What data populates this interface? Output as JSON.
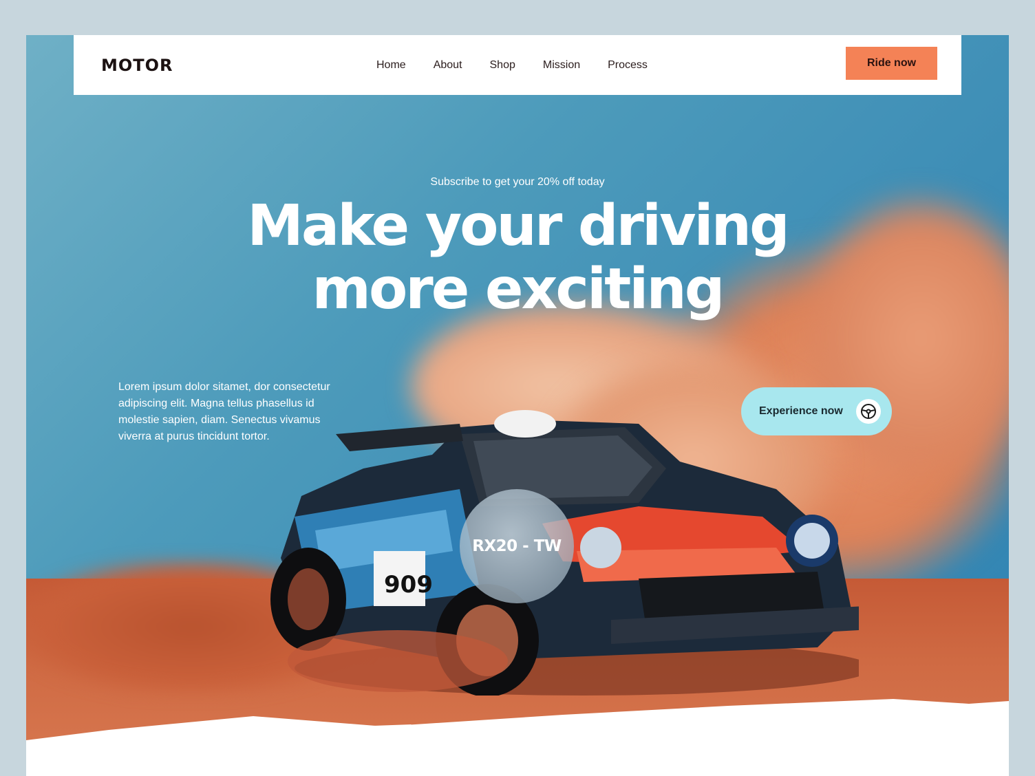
{
  "brand": {
    "logo": "MOTOR"
  },
  "nav": {
    "items": [
      {
        "label": "Home"
      },
      {
        "label": "About"
      },
      {
        "label": "Shop"
      },
      {
        "label": "Mission"
      },
      {
        "label": "Process"
      }
    ],
    "cta_label": "Ride now"
  },
  "hero": {
    "subtitle": "Subscribe to get your 20% off today",
    "headline_line1": "Make your driving",
    "headline_line2": "more exciting",
    "body": "Lorem ipsum dolor sitamet, dor consectetur adipiscing elit. Magna tellus phasellus id molestie sapien, diam. Senectus vivamus viverra at purus tincidunt tortor.",
    "cta_label": "Experience now",
    "cta_icon": "steering-wheel-icon",
    "model_badge": "RX20 - TW",
    "car_number": "909"
  },
  "colors": {
    "accent": "#f48256",
    "cta_secondary": "#a8e7ee",
    "sky": "#3d8db6",
    "dust": "#dd8157",
    "text_dark": "#1b1111"
  }
}
